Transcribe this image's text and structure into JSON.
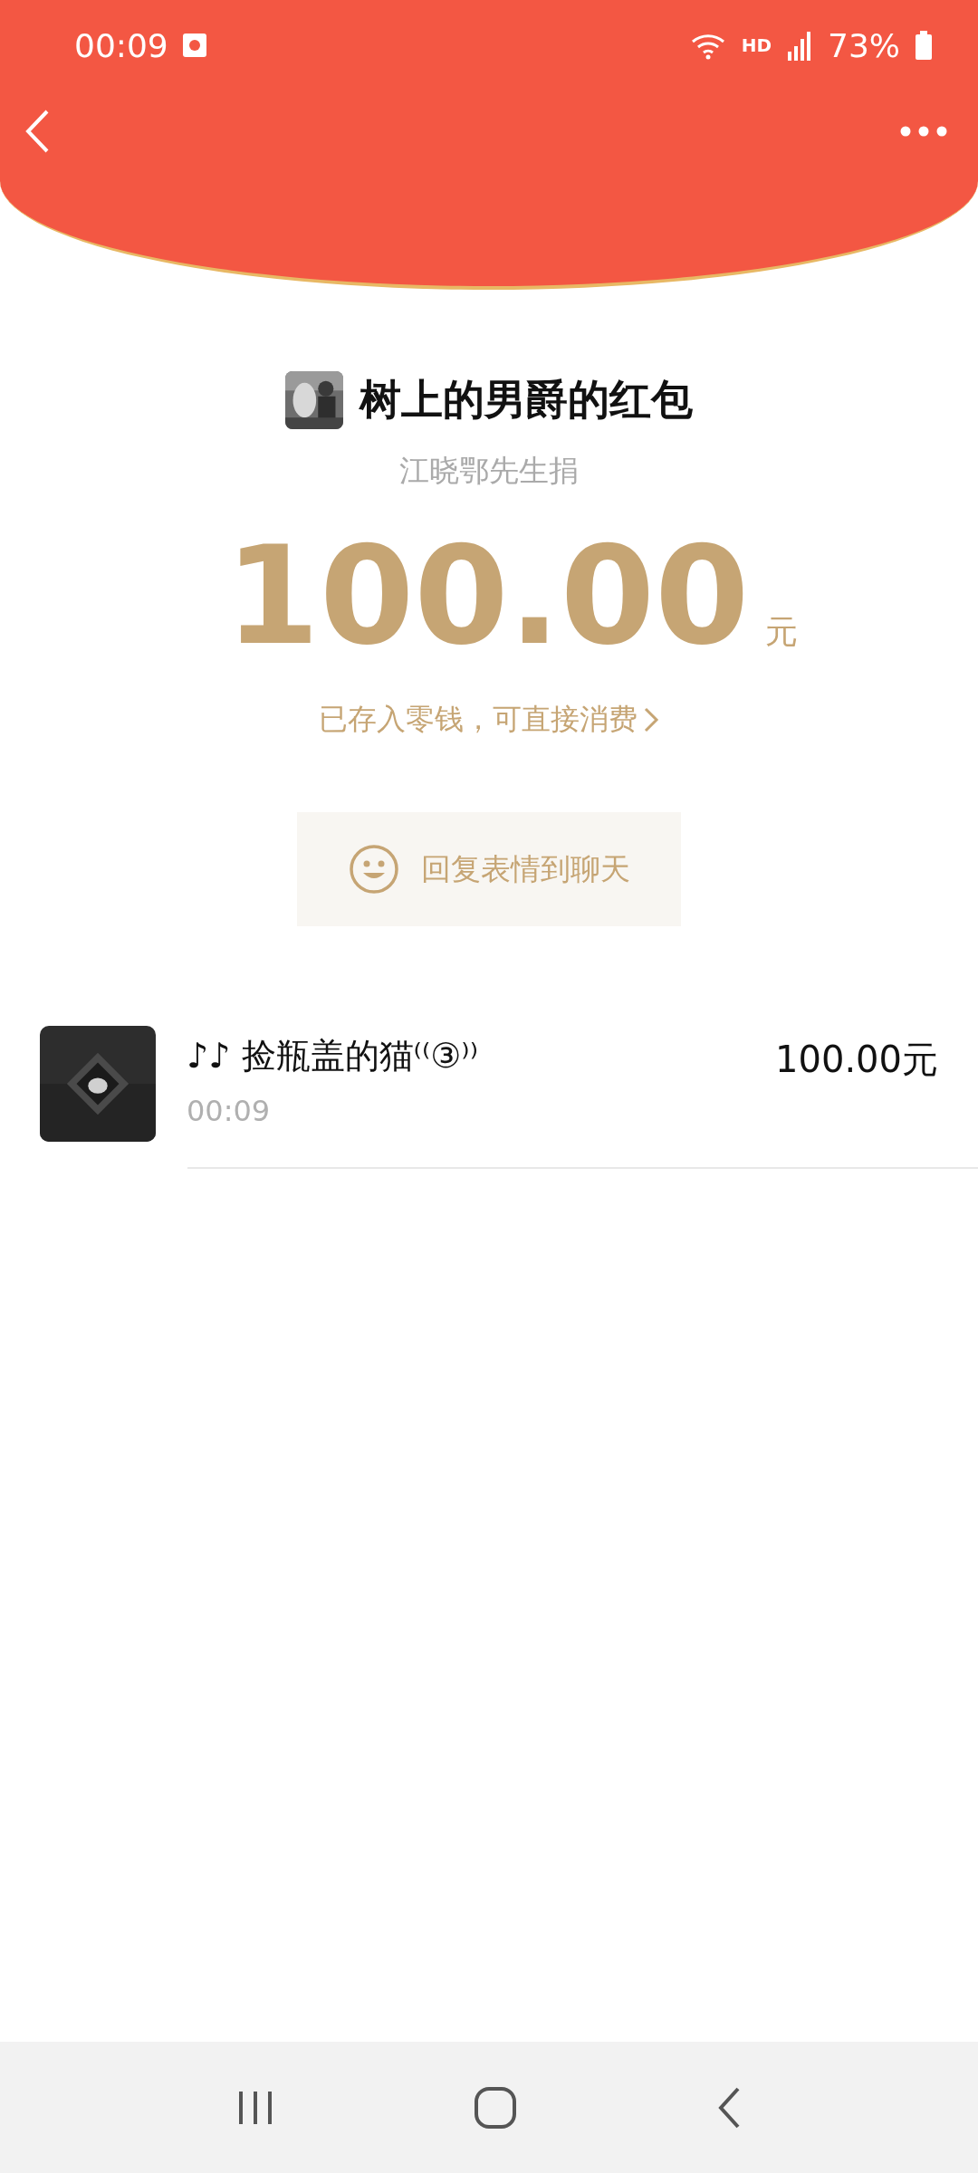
{
  "status_bar": {
    "time": "00:09",
    "network": "HD",
    "battery": "73%"
  },
  "header": {
    "title": "树上的男爵的红包",
    "subtitle": "江晓鄂先生捐"
  },
  "amount": {
    "value": "100.00",
    "unit": "元",
    "note": "已存入零钱，可直接消费"
  },
  "reply_button": {
    "label": "回复表情到聊天"
  },
  "records": [
    {
      "name": "♪♪ 捡瓶盖的猫⁽⁽③⁾⁾",
      "time": "00:09",
      "amount": "100.00元"
    }
  ]
}
